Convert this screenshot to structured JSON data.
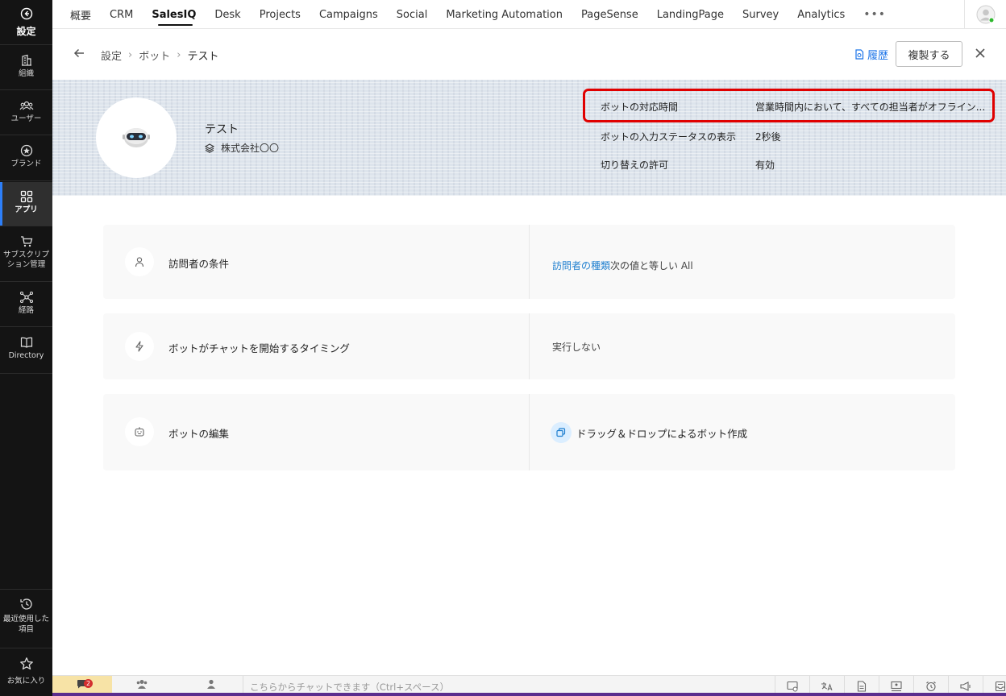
{
  "sidebar": {
    "top_label": "設定",
    "items": [
      {
        "label": "組織",
        "icon": "building-icon"
      },
      {
        "label": "ユーザー",
        "icon": "users-icon"
      },
      {
        "label": "ブランド",
        "icon": "brand-icon"
      },
      {
        "label": "アプリ",
        "icon": "apps-icon",
        "active": true
      },
      {
        "label": "サブスクリプション管理",
        "icon": "cart-icon"
      },
      {
        "label": "経路",
        "icon": "route-icon"
      },
      {
        "label": "Directory",
        "icon": "book-icon"
      }
    ],
    "recent_label": "最近使用した項目",
    "favorites_label": "お気に入り"
  },
  "topnav": {
    "tabs": [
      "概要",
      "CRM",
      "SalesIQ",
      "Desk",
      "Projects",
      "Campaigns",
      "Social",
      "Marketing Automation",
      "PageSense",
      "LandingPage",
      "Survey",
      "Analytics"
    ],
    "active_tab": "SalesIQ",
    "more": "•••"
  },
  "header": {
    "breadcrumb": [
      "設定",
      "ボット",
      "テスト"
    ],
    "history_label": "履歴",
    "duplicate_label": "複製する"
  },
  "bot": {
    "name": "テスト",
    "org": "株式会社〇〇",
    "props": [
      {
        "key": "ボットの対応時間",
        "value": "営業時間内において、すべての担当者がオフライン..."
      },
      {
        "key": "ボットの入力ステータスの表示",
        "value": "2秒後"
      },
      {
        "key": "切り替えの許可",
        "value": "有効"
      }
    ]
  },
  "cards": {
    "visitor": {
      "title": "訪問者の条件",
      "link": "訪問者の種類",
      "rest": "次の値と等しい All"
    },
    "timing": {
      "title": "ボットがチャットを開始するタイミング",
      "value": "実行しない"
    },
    "edit": {
      "title": "ボットの編集",
      "value": "ドラッグ＆ドロップによるボット作成"
    }
  },
  "bottombar": {
    "badge": "2",
    "chat_placeholder": "こちらからチャットできます（Ctrl+スペース）"
  },
  "colors": {
    "highlight": "#e00000",
    "link": "#1f7fcf",
    "sidebar_bg": "#141414",
    "accent": "#2d7ff9"
  }
}
